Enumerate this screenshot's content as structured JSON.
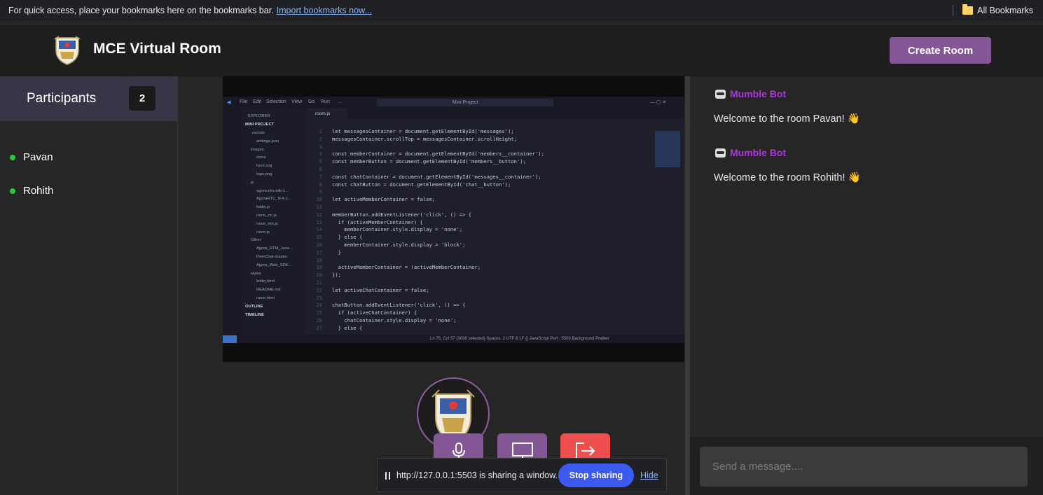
{
  "browser": {
    "bookmarks_hint": "For quick access, place your bookmarks here on the bookmarks bar.",
    "import_link": "Import bookmarks now...",
    "all_bookmarks": "All Bookmarks"
  },
  "header": {
    "title": "MCE Virtual Room",
    "create_room": "Create Room"
  },
  "participants": {
    "title": "Participants",
    "count": "2",
    "members": [
      "Pavan",
      "Rohith"
    ]
  },
  "shared_screen": {
    "menu": [
      "File",
      "Edit",
      "Selection",
      "View",
      "Go",
      "Run",
      "..."
    ],
    "search": "Mini Project",
    "explorer_title": "EXPLORER",
    "project": "MINI PROJECT",
    "tree": [
      ".vscode",
      "settings.json",
      "images",
      "icons",
      "hero.svg",
      "logo.png",
      "js",
      "agora-rtm-sdk-1...",
      "AgoraRTC_N-4.2...",
      "lobby.js",
      "room_rtc.js",
      "room_rtm.js",
      "room.js",
      "Other",
      "Agora_RTM_Java...",
      "PeerChat-master",
      "Agora_Web_SDK...",
      "styles",
      "lobby.html",
      "README.md",
      "room.html",
      "OUTLINE",
      "TIMELINE"
    ],
    "tab": "room.js",
    "code_lines": [
      "let messagesContainer = document.getElementById('messages');",
      "messagesContainer.scrollTop = messagesContainer.scrollHeight;",
      "",
      "const memberContainer = document.getElementById('members__container');",
      "const memberButton = document.getElementById('members__button');",
      "",
      "const chatContainer = document.getElementById('messages__container');",
      "const chatButton = document.getElementById('chat__button');",
      "",
      "let activeMemberContainer = false;",
      "",
      "memberButton.addEventListener('click', () => {",
      "  if (activeMemberContainer) {",
      "    memberContainer.style.display = 'none';",
      "  } else {",
      "    memberContainer.style.display = 'block';",
      "  }",
      "",
      "  activeMemberContainer = !activeMemberContainer;",
      "});",
      "",
      "let activeChatContainer = false;",
      "",
      "chatButton.addEventListener('click', () => {",
      "  if (activeChatContainer) {",
      "    chatContainer.style.display = 'none';",
      "  } else {"
    ],
    "status_bar": "Ln 76, Col 57 (3036 selected)   Spaces: 2   UTF-8   LF   {} JavaScript   Port : 5503   Background   Prettier"
  },
  "controls": {
    "mic": "mic-icon",
    "screen": "monitor-icon",
    "leave": "leave-icon"
  },
  "share_banner": {
    "text": "http://127.0.0.1:5503 is sharing a window.",
    "stop": "Stop sharing",
    "hide": "Hide"
  },
  "chat": {
    "messages": [
      {
        "author": "Mumble Bot",
        "text": "Welcome to the room Pavan!"
      },
      {
        "author": "Mumble Bot",
        "text": "Welcome to the room Rohith!"
      }
    ],
    "input_placeholder": "Send a message...."
  },
  "colors": {
    "accent": "#845695",
    "bot_name": "#a63ad4",
    "leave": "#ee4e4e",
    "online": "#2aca3e",
    "stop_sharing": "#3d5aee"
  }
}
